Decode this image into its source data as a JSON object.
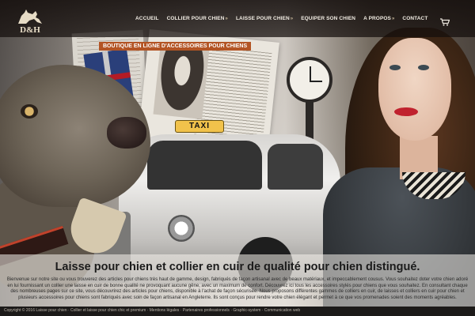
{
  "brand": {
    "logo_text": "D&H"
  },
  "nav": {
    "items": [
      {
        "label": "ACCUEIL",
        "has_submenu": false
      },
      {
        "label": "COLLIER POUR CHIEN",
        "has_submenu": true
      },
      {
        "label": "LAISSE POUR CHIEN",
        "has_submenu": true
      },
      {
        "label": "EQUIPER SON CHIEN",
        "has_submenu": false
      },
      {
        "label": "A PROPOS",
        "has_submenu": true
      },
      {
        "label": "CONTACT",
        "has_submenu": false
      }
    ],
    "cart_icon": "shopping-cart-icon"
  },
  "hero": {
    "badge": "BOUTIQUE EN LIGNE D'ACCESSOIRES POUR CHIENS",
    "taxi_sign": "TAXI",
    "headline": "Laisse pour chien et collier en cuir de qualité pour chien distingué.",
    "intro": "Bienvenue sur notre site ou vous trouverez des articles pour chiens très haut de gamme, design, fabriqués de façon artisanal avec de beaux matériaux, et impeccablement cousus. Vous souhaitez doter votre chien adoré en lui fournissant un collier une laisse en cuir de bonne qualité ne provoquant aucune gêne, avec un maximum de confort. Découvrez ici tous les accessoires stylés pour chiens que vous souhaitez. En consultant chaque des nombreuses pages sur ce site, vous découvrirez des articles pour chiens, disponible à l'achat de façon sécurisée. Nous proposons différentes gammes de colliers en cuir, de laisses et colliers en cuir pour chien et plusieurs accessoires pour chiens sont fabriqués avec soin de façon artisanal en Angleterre. Ils sont conçus pour rendre votre chien élégant et permet à ce que vos promenades soient des moments agréables."
  },
  "footer": {
    "text": "Copyright © 2016 Laisse pour chien · Collier et laisse pour chien chic et premium · Mentions légales · Partenaires professionnels · Graphic-system · Communication web"
  },
  "colors": {
    "badge": "#b35424",
    "topbar": "#140e0c",
    "accent_lips": "#c0222e"
  }
}
